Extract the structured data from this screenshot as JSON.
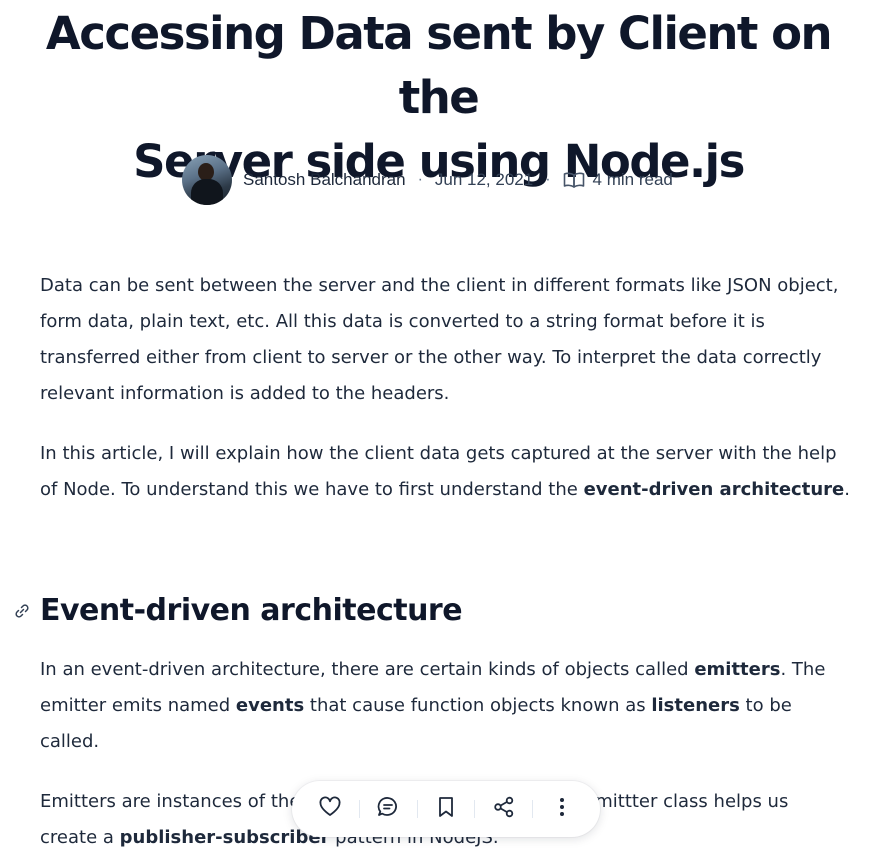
{
  "article": {
    "title_line1": "Accessing Data sent by Client on the",
    "title_line2": "Server side using Node.js",
    "author": "Santosh Balchandran",
    "separator": "·",
    "date": "Jun 12, 2021",
    "read_time": "4 min read",
    "paragraphs": {
      "p1": "Data can be sent between the server and the client in different formats like JSON object, form data, plain text, etc. All this data is converted to a string format before it is transferred either from client to server or the other way. To interpret the data correctly relevant information is added to the headers.",
      "p2_a": "In this article, I will explain how the client data gets captured at the server with the help of Node. To understand this we have to first understand the ",
      "p2_b": "event-driven architecture",
      "p2_c": "."
    },
    "heading": "Event-driven architecture",
    "section": {
      "p3_a": "In an event-driven architecture, there are certain kinds of objects called ",
      "p3_b": "emitters",
      "p3_c": ". The emitter emits named ",
      "p3_d": "events",
      "p3_e": " that cause function objects known as ",
      "p3_f": "listeners",
      "p3_g": " to be called.",
      "p4_a": "Emitters are instances of the EventEmittter class. The EventEmittter class helps us create a ",
      "p4_b": "publisher-subscriber",
      "p4_c": " pattern in NodeJS."
    }
  },
  "toolbar": {
    "icons": [
      "heart-icon",
      "comment-icon",
      "bookmark-icon",
      "share-icon",
      "more-icon"
    ]
  },
  "colors": {
    "text": "#1e293b",
    "heading": "#0f172a",
    "muted": "#64748b"
  }
}
